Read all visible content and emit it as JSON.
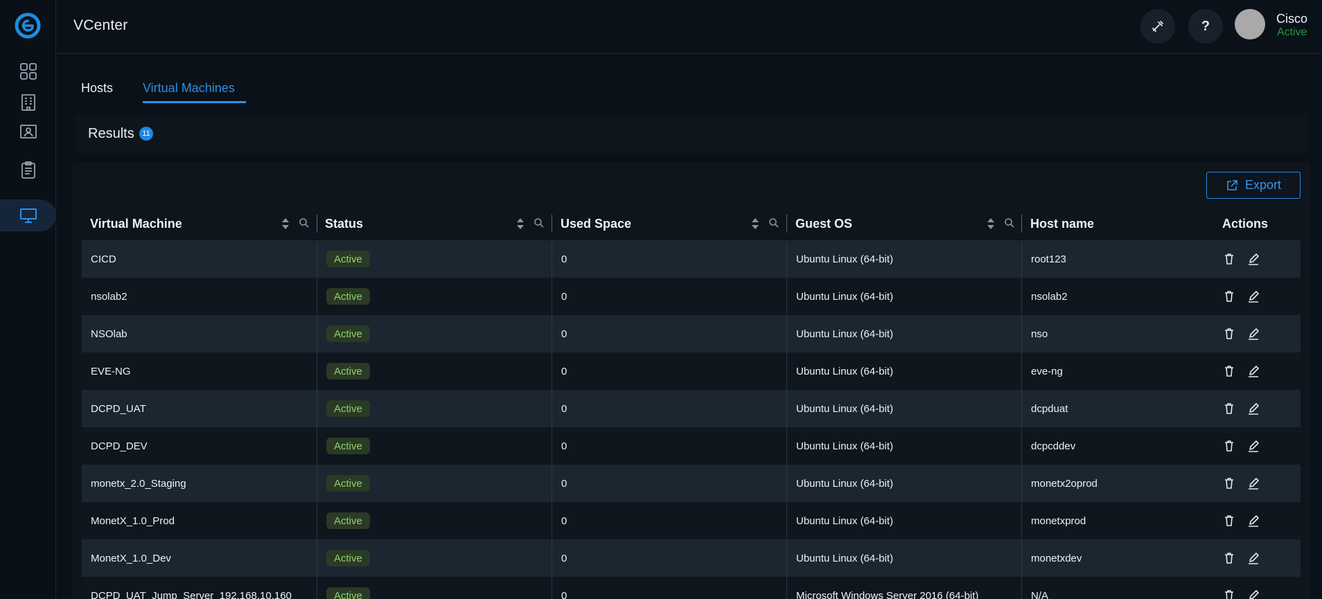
{
  "app": {
    "title": "VCenter"
  },
  "sidebar": {
    "items": [
      {
        "name": "dashboard",
        "icon": "grid-icon"
      },
      {
        "name": "inventory",
        "icon": "building-icon"
      },
      {
        "name": "contacts",
        "icon": "id-card-icon"
      },
      {
        "name": "reports",
        "icon": "clipboard-icon"
      },
      {
        "name": "vcenter",
        "icon": "monitor-icon",
        "active": true
      }
    ]
  },
  "header": {
    "user_name": "Cisco",
    "user_status": "Active",
    "help_label": "?"
  },
  "tabs": [
    {
      "label": "Hosts",
      "active": false
    },
    {
      "label": "Virtual Machines",
      "active": true
    }
  ],
  "results": {
    "title": "Results",
    "count": "11"
  },
  "toolbar": {
    "export_label": "Export"
  },
  "table": {
    "columns": [
      "Virtual Machine",
      "Status",
      "Used Space",
      "Guest OS",
      "Host name",
      "Actions"
    ],
    "rows": [
      {
        "vm": "CICD",
        "status": "Active",
        "used": "0",
        "os": "Ubuntu Linux (64-bit)",
        "host": "root123"
      },
      {
        "vm": "nsolab2",
        "status": "Active",
        "used": "0",
        "os": "Ubuntu Linux (64-bit)",
        "host": "nsolab2"
      },
      {
        "vm": "NSOlab",
        "status": "Active",
        "used": "0",
        "os": "Ubuntu Linux (64-bit)",
        "host": "nso"
      },
      {
        "vm": "EVE-NG",
        "status": "Active",
        "used": "0",
        "os": "Ubuntu Linux (64-bit)",
        "host": "eve-ng"
      },
      {
        "vm": "DCPD_UAT",
        "status": "Active",
        "used": "0",
        "os": "Ubuntu Linux (64-bit)",
        "host": "dcpduat"
      },
      {
        "vm": "DCPD_DEV",
        "status": "Active",
        "used": "0",
        "os": "Ubuntu Linux (64-bit)",
        "host": "dcpcddev"
      },
      {
        "vm": "monetx_2.0_Staging",
        "status": "Active",
        "used": "0",
        "os": "Ubuntu Linux (64-bit)",
        "host": "monetx2oprod"
      },
      {
        "vm": "MonetX_1.0_Prod",
        "status": "Active",
        "used": "0",
        "os": "Ubuntu Linux (64-bit)",
        "host": "monetxprod"
      },
      {
        "vm": "MonetX_1.0_Dev",
        "status": "Active",
        "used": "0",
        "os": "Ubuntu Linux (64-bit)",
        "host": "monetxdev"
      },
      {
        "vm": "DCPD_UAT_Jump_Server_192.168.10.160",
        "status": "Active",
        "used": "0",
        "os": "Microsoft Windows Server 2016 (64-bit)",
        "host": "N/A"
      }
    ]
  },
  "colors": {
    "accent": "#2e8fe6",
    "active_green": "#1f9d3a",
    "status_badge_bg": "#2a3a25",
    "status_badge_text": "#8ed16a"
  }
}
